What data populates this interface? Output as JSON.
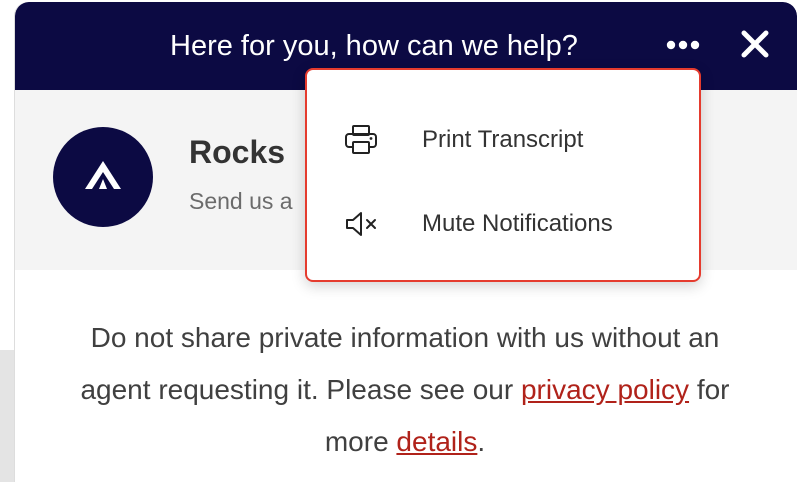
{
  "header": {
    "title": "Here for you, how can we help?",
    "more_icon": "more-horizontal-icon",
    "close_icon": "close-icon",
    "background_color": "#0c0a43"
  },
  "agent": {
    "name": "Rocks",
    "subtitle": "Send us a",
    "avatar_icon": "brand-logo-icon"
  },
  "menu": {
    "border_color": "#e53b2e",
    "items": [
      {
        "label": "Print Transcript",
        "icon": "printer-icon"
      },
      {
        "label": "Mute Notifications",
        "icon": "speaker-muted-icon"
      }
    ]
  },
  "notice": {
    "text_before": "Do not share private information with us without an agent requesting it. Please see our ",
    "privacy_link": "privacy policy",
    "text_middle": " for more ",
    "details_link": "details",
    "text_after": ".",
    "link_color": "#b0221a"
  }
}
